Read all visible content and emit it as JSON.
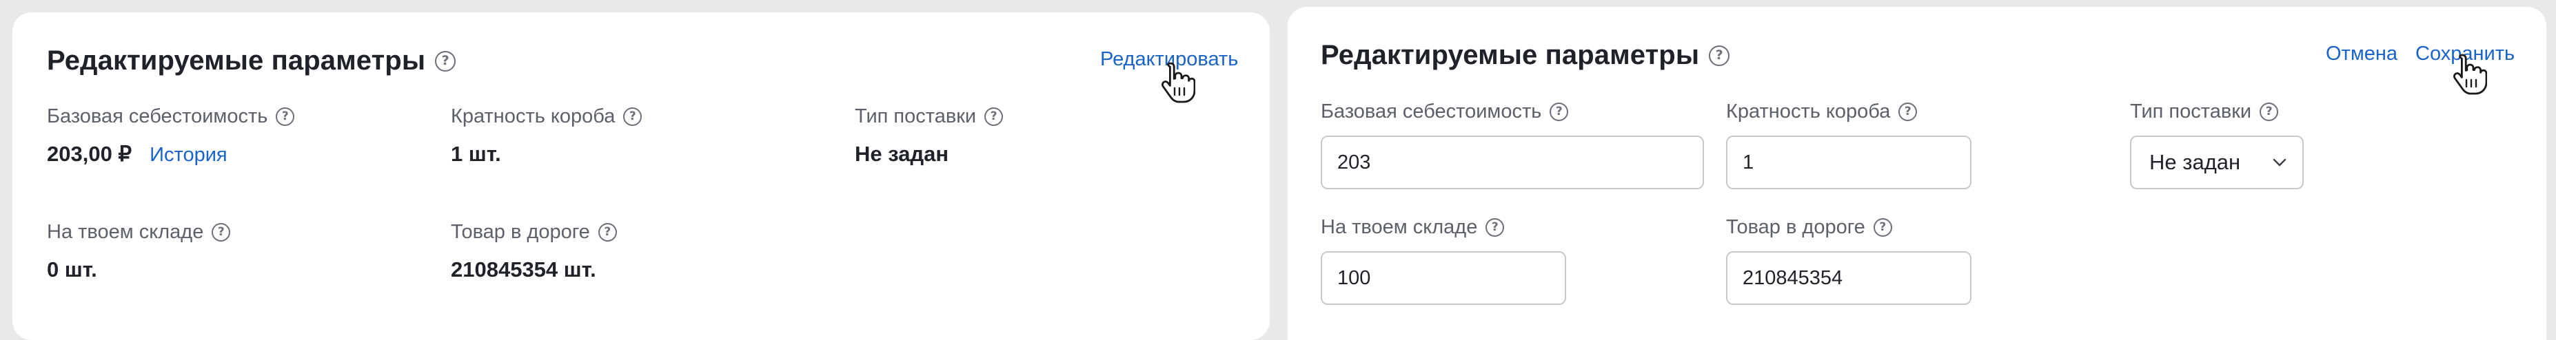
{
  "view_mode": {
    "title": "Редактируемые параметры",
    "edit_link": "Редактировать",
    "fields": {
      "base_cost": {
        "label": "Базовая себестоимость",
        "value": "203,00 ₽",
        "history_link": "История"
      },
      "box_multiplicity": {
        "label": "Кратность короба",
        "value": "1 шт."
      },
      "supply_type": {
        "label": "Тип поставки",
        "value": "Не задан"
      },
      "your_warehouse": {
        "label": "На твоем складе",
        "value": "0 шт."
      },
      "in_transit": {
        "label": "Товар в дороге",
        "value": "210845354 шт."
      }
    }
  },
  "edit_mode": {
    "title": "Редактируемые параметры",
    "cancel_link": "Отмена",
    "save_link": "Сохранить",
    "fields": {
      "base_cost": {
        "label": "Базовая себестоимость",
        "value": "203"
      },
      "box_multiplicity": {
        "label": "Кратность короба",
        "value": "1"
      },
      "supply_type": {
        "label": "Тип поставки",
        "selected": "Не задан"
      },
      "your_warehouse": {
        "label": "На твоем складе",
        "value": "100"
      },
      "in_transit": {
        "label": "Товар в дороге",
        "value": "210845354"
      }
    }
  },
  "icons": {
    "help": "question-circle-icon",
    "cursor": "hand-pointer-cursor",
    "chevron": "chevron-down-icon"
  },
  "colors": {
    "link": "#1a63c9",
    "background": "#e8e9eb",
    "panel": "#ffffff",
    "border": "#c5c9cf"
  }
}
